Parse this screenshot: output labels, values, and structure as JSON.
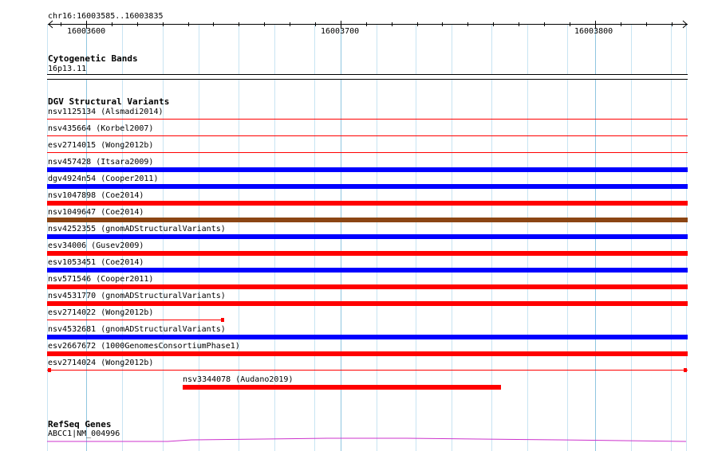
{
  "ruler": {
    "location": "chr16:16003585..16003835",
    "ticks": [
      "16003600",
      "16003700",
      "16003800"
    ]
  },
  "tracks": {
    "cytobands": {
      "title": "Cytogenetic Bands",
      "band": "16p13.11"
    },
    "dgv": {
      "title": "DGV Structural Variants",
      "variants": [
        {
          "label": "nsv1125134 (Alsmadi2014)",
          "color": "#ff0000",
          "style": "thin"
        },
        {
          "label": "nsv435664 (Korbel2007)",
          "color": "#ff0000",
          "style": "thin"
        },
        {
          "label": "esv2714015 (Wong2012b)",
          "color": "#ff0000",
          "style": "thin"
        },
        {
          "label": "nsv457428 (Itsara2009)",
          "color": "#0000ff",
          "style": "thick"
        },
        {
          "label": "dgv4924n54 (Cooper2011)",
          "color": "#0000ff",
          "style": "thick"
        },
        {
          "label": "nsv1047898 (Coe2014)",
          "color": "#ff0000",
          "style": "thick"
        },
        {
          "label": "nsv1049647 (Coe2014)",
          "color": "#8b4513",
          "style": "thick"
        },
        {
          "label": "nsv4252355 (gnomADStructuralVariants)",
          "color": "#0000ff",
          "style": "thick"
        },
        {
          "label": "esv34006 (Gusev2009)",
          "color": "#ff0000",
          "style": "thick"
        },
        {
          "label": "esv1053451 (Coe2014)",
          "color": "#0000ff",
          "style": "thick"
        },
        {
          "label": "nsv571546 (Cooper2011)",
          "color": "#ff0000",
          "style": "thick"
        },
        {
          "label": "nsv4531770 (gnomADStructuralVariants)",
          "color": "#ff0000",
          "style": "thick"
        },
        {
          "label": "esv2714022 (Wong2012b)",
          "color": "#ff0000",
          "style": "thin-end"
        },
        {
          "label": "nsv4532681 (gnomADStructuralVariants)",
          "color": "#0000ff",
          "style": "thick"
        },
        {
          "label": "esv2667672 (1000GenomesConsortiumPhase1)",
          "color": "#ff0000",
          "style": "thick"
        },
        {
          "label": "esv2714024 (Wong2012b)",
          "color": "#ff0000",
          "style": "thin-both"
        },
        {
          "label": "nsv3344078 (Audano2019)",
          "color": "#ff0000",
          "style": "thick-partial"
        }
      ]
    },
    "refseq": {
      "title": "RefSeq Genes",
      "gene": "ABCC1|NM_004996",
      "color": "#cc33cc"
    }
  }
}
